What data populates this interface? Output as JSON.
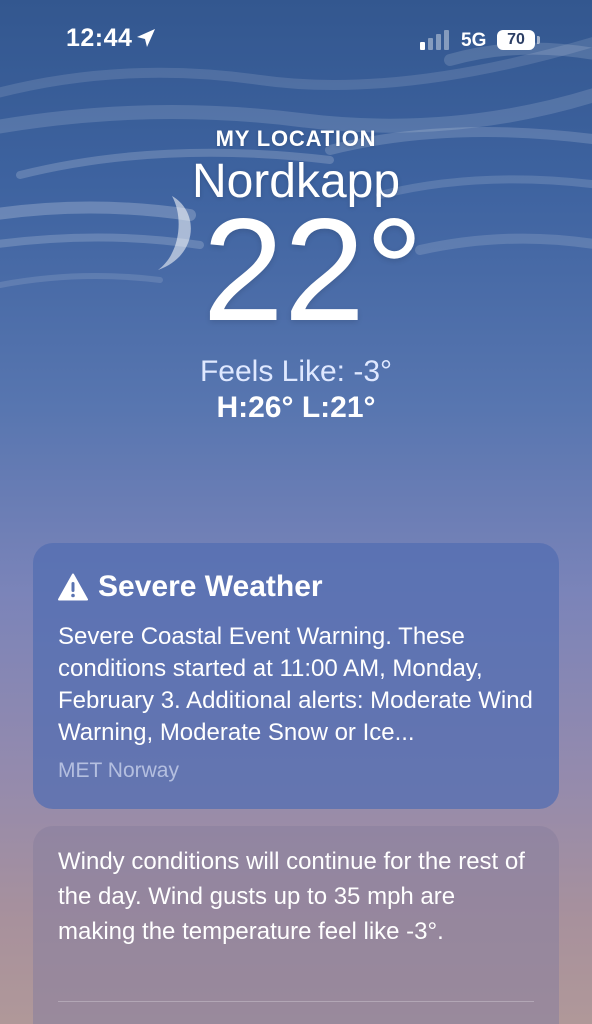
{
  "status_bar": {
    "time": "12:44",
    "network": "5G",
    "battery": "70",
    "icons": [
      "location-arrow-icon",
      "signal-icon",
      "battery-icon"
    ]
  },
  "header": {
    "subtitle": "MY LOCATION",
    "city": "Nordkapp",
    "temperature": "22°",
    "feels_like": "Feels Like: -3°",
    "high_low": "H:26°  L:21°"
  },
  "severe_weather": {
    "icon": "warning-triangle-icon",
    "title": "Severe Weather",
    "text": "Severe Coastal Event Warning. These conditions started at 11:00 AM, Monday, February 3. Additional alerts: Moderate Wind Warning, Moderate Snow or Ice...",
    "source": "MET Norway"
  },
  "wind_summary": {
    "text": "Windy conditions will continue for the rest of the day. Wind gusts up to 35 mph are making the temperature feel like -3°."
  },
  "colors": {
    "sky_top": "#33578f",
    "sky_bottom": "#b09899",
    "severe_card": "#536eb2",
    "feels_like_text": "#dfe8ff"
  }
}
